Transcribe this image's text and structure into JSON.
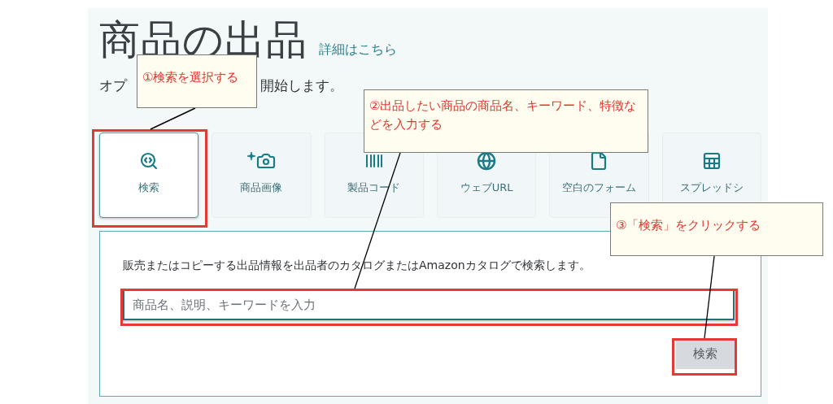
{
  "title": "商品の出品",
  "help_link": "詳細はこちら",
  "subtitle": [
    "オプ",
    "開始します。"
  ],
  "tiles": [
    {
      "label": "検索",
      "selected": true
    },
    {
      "label": "商品画像",
      "selected": false
    },
    {
      "label": "製品コード",
      "selected": false
    },
    {
      "label": "ウェブURL",
      "selected": false
    },
    {
      "label": "空白のフォーム",
      "selected": false
    },
    {
      "label": "スプレッドシ",
      "selected": false
    }
  ],
  "search": {
    "description": "販売またはコピーする出品情報を出品者のカタログまたはAmazonカタログで検索します。",
    "placeholder": "商品名、説明、キーワードを入力",
    "button": "検索"
  },
  "callouts": [
    {
      "text": "①検索を選択する"
    },
    {
      "text": "②出品したい商品の商品名、キーワード、特徴などを入力する"
    },
    {
      "text": "③「検索」をクリックする"
    }
  ]
}
